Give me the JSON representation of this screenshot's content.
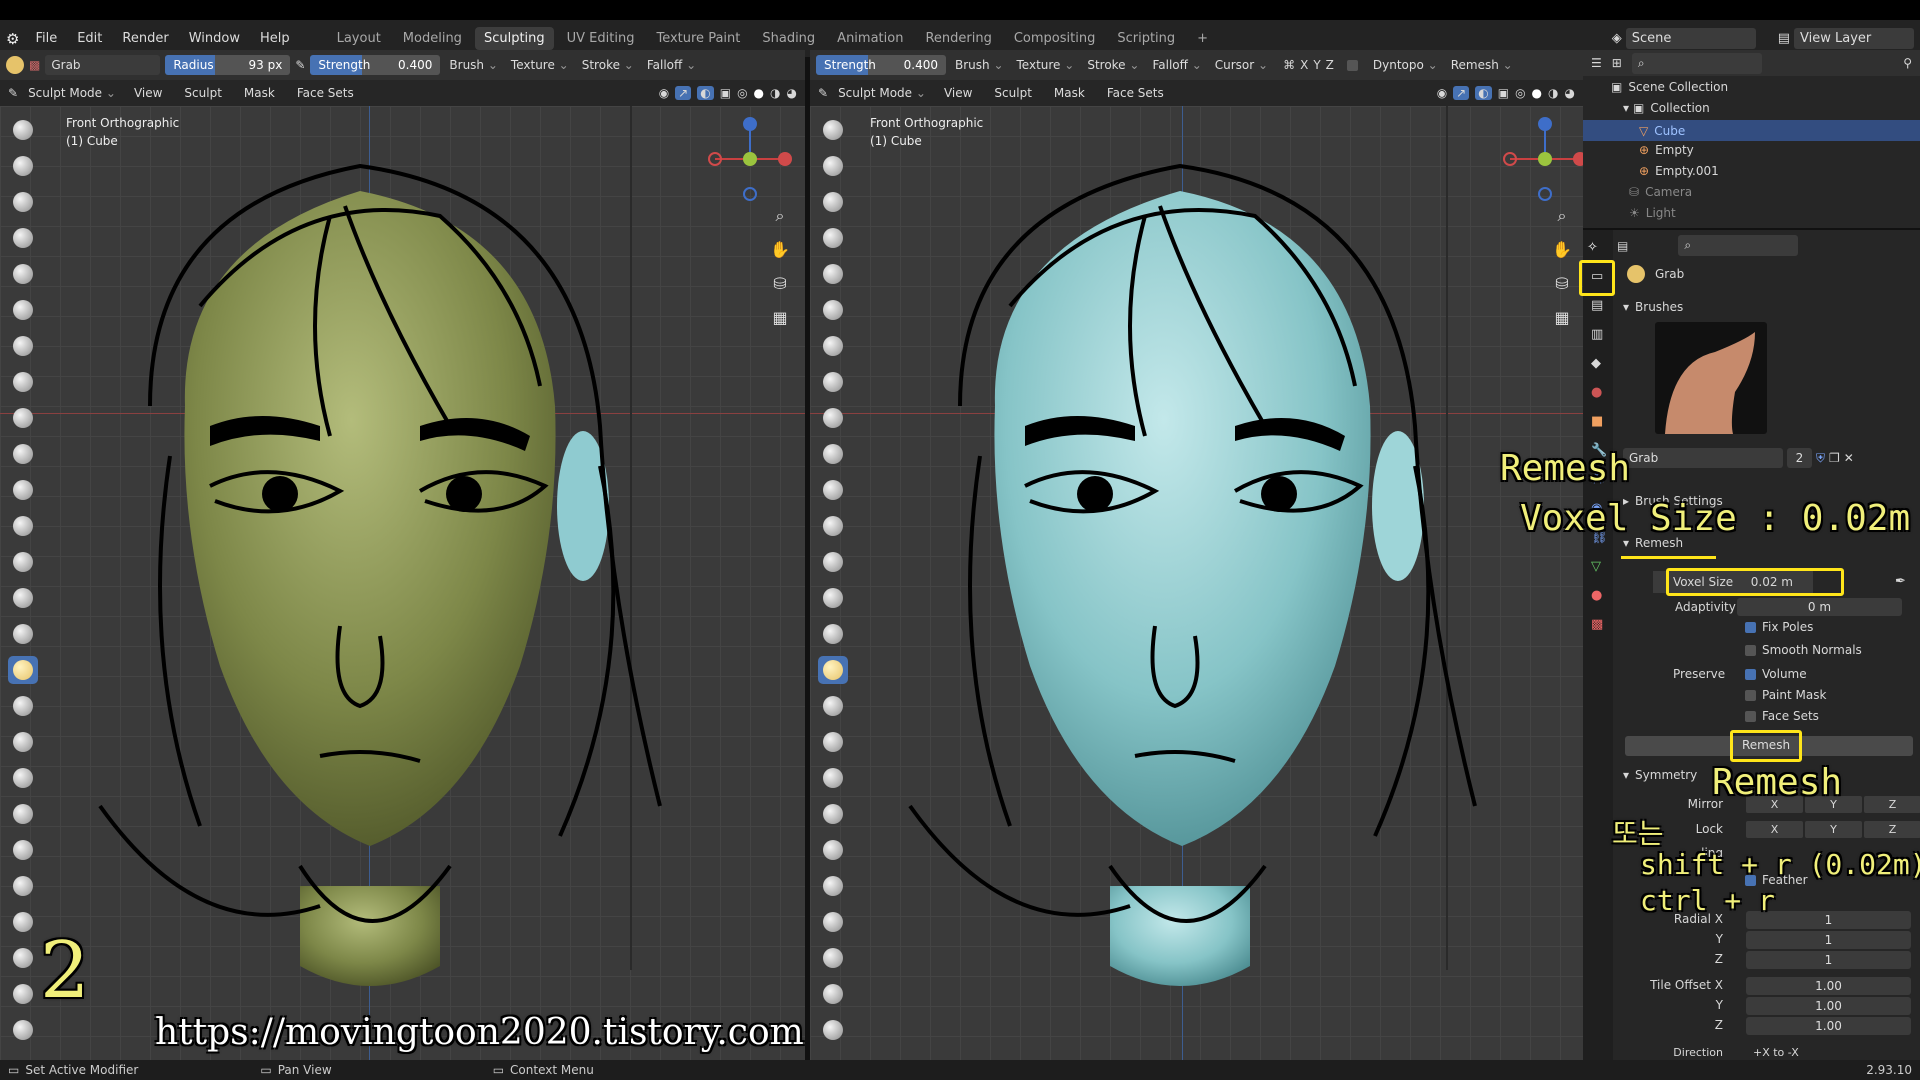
{
  "menubar": {
    "items": [
      "File",
      "Edit",
      "Render",
      "Window",
      "Help"
    ],
    "workspace_tabs": [
      "Layout",
      "Modeling",
      "Sculpting",
      "UV Editing",
      "Texture Paint",
      "Shading",
      "Animation",
      "Rendering",
      "Compositing",
      "Scripting",
      "+"
    ],
    "scene": "Scene",
    "view_layer": "View Layer"
  },
  "left_header": {
    "brush": "Grab",
    "radius_label": "Radius",
    "radius_value": "93 px",
    "strength_label": "Strength",
    "strength_value": "0.400",
    "dropdowns": [
      "Brush",
      "Texture",
      "Stroke",
      "Falloff"
    ]
  },
  "right_header": {
    "strength_label": "Strength",
    "strength_value": "0.400",
    "dropdowns": [
      "Brush",
      "Texture",
      "Stroke",
      "Falloff",
      "Cursor"
    ],
    "axes": [
      "X",
      "Y",
      "Z"
    ],
    "dyntopo": "Dyntopo",
    "remesh": "Remesh"
  },
  "sub_header": {
    "mode": "Sculpt Mode",
    "items": [
      "View",
      "Sculpt",
      "Mask",
      "Face Sets"
    ]
  },
  "viewport": {
    "view_name": "Front Orthographic",
    "object": "(1) Cube",
    "gizmo_z": "Z",
    "gizmo_y": "Y",
    "gizmo_x": "X"
  },
  "outliner": {
    "root": "Scene Collection",
    "collection": "Collection",
    "items": [
      "Cube",
      "Empty",
      "Empty.001",
      "Camera",
      "Light"
    ]
  },
  "properties": {
    "brush_name": "Grab",
    "brushes_panel": "Brushes",
    "brush_field": "Grab",
    "brush_users": "2",
    "brush_settings": "Brush Settings",
    "remesh_panel": "Remesh",
    "voxel_size_label": "Voxel Size",
    "voxel_size_value": "0.02 m",
    "adaptivity_label": "Adaptivity",
    "adaptivity_value": "0 m",
    "fix_poles": "Fix Poles",
    "smooth_normals": "Smooth Normals",
    "preserve_label": "Preserve",
    "volume": "Volume",
    "paint_mask": "Paint Mask",
    "face_sets": "Face Sets",
    "remesh_button": "Remesh",
    "symmetry_panel": "Symmetry",
    "mirror_label": "Mirror",
    "lock_label": "Lock",
    "tiling_label": "ling",
    "feather": "Feather",
    "radial_label": "Radial X",
    "y_label": "Y",
    "z_label": "Z",
    "radial": [
      "1",
      "1",
      "1"
    ],
    "tile_offset_label": "Tile Offset X",
    "tile_offset": [
      "1.00",
      "1.00",
      "1.00"
    ],
    "direction_label": "Direction",
    "direction_value": "+X to -X"
  },
  "annotations": {
    "number": "2",
    "remesh_title": "Remesh",
    "voxel_note": "Voxel Size : 0.02m",
    "remesh_button_note": "Remesh",
    "or": "또는",
    "shortcut1": "shift + r (0.02m)",
    "shortcut2": "ctrl + r",
    "url": "https://movingtoon2020.tistory.com"
  },
  "statusbar": {
    "left": "Set Active Modifier",
    "pan": "Pan View",
    "context": "Context Menu",
    "version": "2.93.10"
  },
  "colors": {
    "left_head": "#7d8748",
    "right_head": "#86c4c7",
    "accent": "#4772b3",
    "highlight": "#ffe51a"
  }
}
